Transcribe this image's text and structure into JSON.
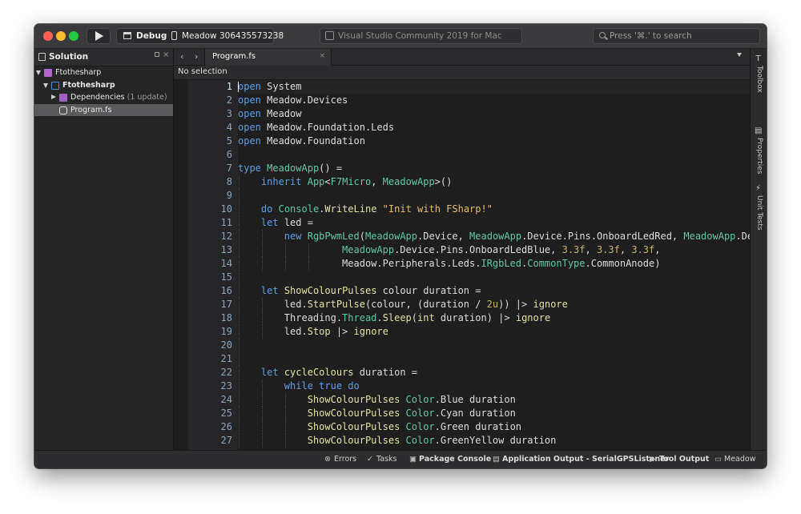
{
  "toolbar": {
    "configuration": "Debug",
    "separator": "›",
    "device": "Meadow  306435573238",
    "status_text": "Visual Studio Community 2019 for Mac",
    "search_placeholder": "Press '⌘.' to search"
  },
  "solution_pane": {
    "title": "Solution",
    "close_glyph": "×",
    "items": [
      {
        "label": "Ftothesharp",
        "extra": "",
        "icon": "solution-icon"
      },
      {
        "label": "Ftothesharp",
        "extra": "",
        "icon": "project-icon"
      },
      {
        "label": "Dependencies",
        "extra": " (1 update)",
        "icon": "dependencies-icon"
      },
      {
        "label": "Program.fs",
        "extra": "",
        "icon": "fsharp-file-icon"
      }
    ]
  },
  "editor": {
    "nav_back": "‹",
    "nav_forward": "›",
    "tab_label": "Program.fs",
    "tab_close": "×",
    "path_text": "No selection",
    "ok_mark": "✓",
    "line_numbers": [
      "1",
      "2",
      "3",
      "4",
      "5",
      "6",
      "7",
      "8",
      "9",
      "10",
      "11",
      "12",
      "13",
      "14",
      "15",
      "16",
      "17",
      "18",
      "19",
      "20",
      "21",
      "22",
      "23",
      "24",
      "25",
      "26",
      "27"
    ]
  },
  "right_dock": {
    "items": [
      {
        "label": "Toolbox",
        "glyph": "T"
      },
      {
        "label": "Properties",
        "glyph": "▤"
      },
      {
        "label": "Unit Tests",
        "glyph": "⚡"
      }
    ]
  },
  "bottom_pads": {
    "errors": "Errors",
    "tasks": "Tasks",
    "package_console": "Package Console",
    "application_output": "Application Output - SerialGPSListener",
    "tool_output": "Tool Output",
    "meadow": "Meadow"
  },
  "colors": {
    "keyword": "#5e9fe8",
    "type": "#61c6a7",
    "string": "#e8bb6c",
    "number": "#c7b36a",
    "ok": "#45c16a"
  }
}
